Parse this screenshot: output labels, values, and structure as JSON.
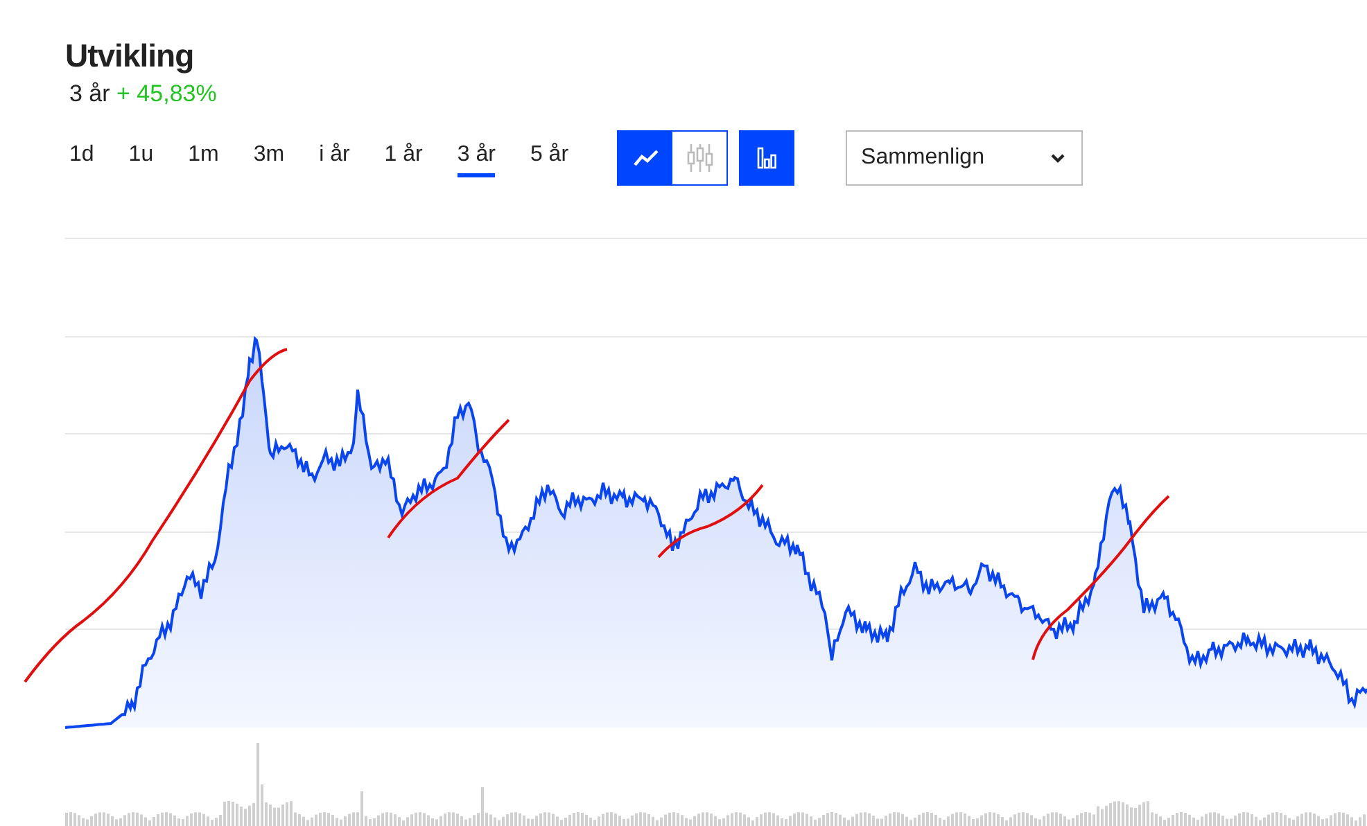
{
  "header": {
    "title": "Utvikling",
    "period": "3 år",
    "change": "+ 45,83%"
  },
  "periods": [
    {
      "label": "1d",
      "selected": false
    },
    {
      "label": "1u",
      "selected": false
    },
    {
      "label": "1m",
      "selected": false
    },
    {
      "label": "3m",
      "selected": false
    },
    {
      "label": "i år",
      "selected": false
    },
    {
      "label": "1 år",
      "selected": false
    },
    {
      "label": "3 år",
      "selected": true
    },
    {
      "label": "5 år",
      "selected": false
    }
  ],
  "chart_types": [
    {
      "kind": "line",
      "selected": true
    },
    {
      "kind": "candlestick",
      "selected": false
    }
  ],
  "volume_toggle": {
    "on": true
  },
  "compare": {
    "value": "Sammenlign"
  }
}
